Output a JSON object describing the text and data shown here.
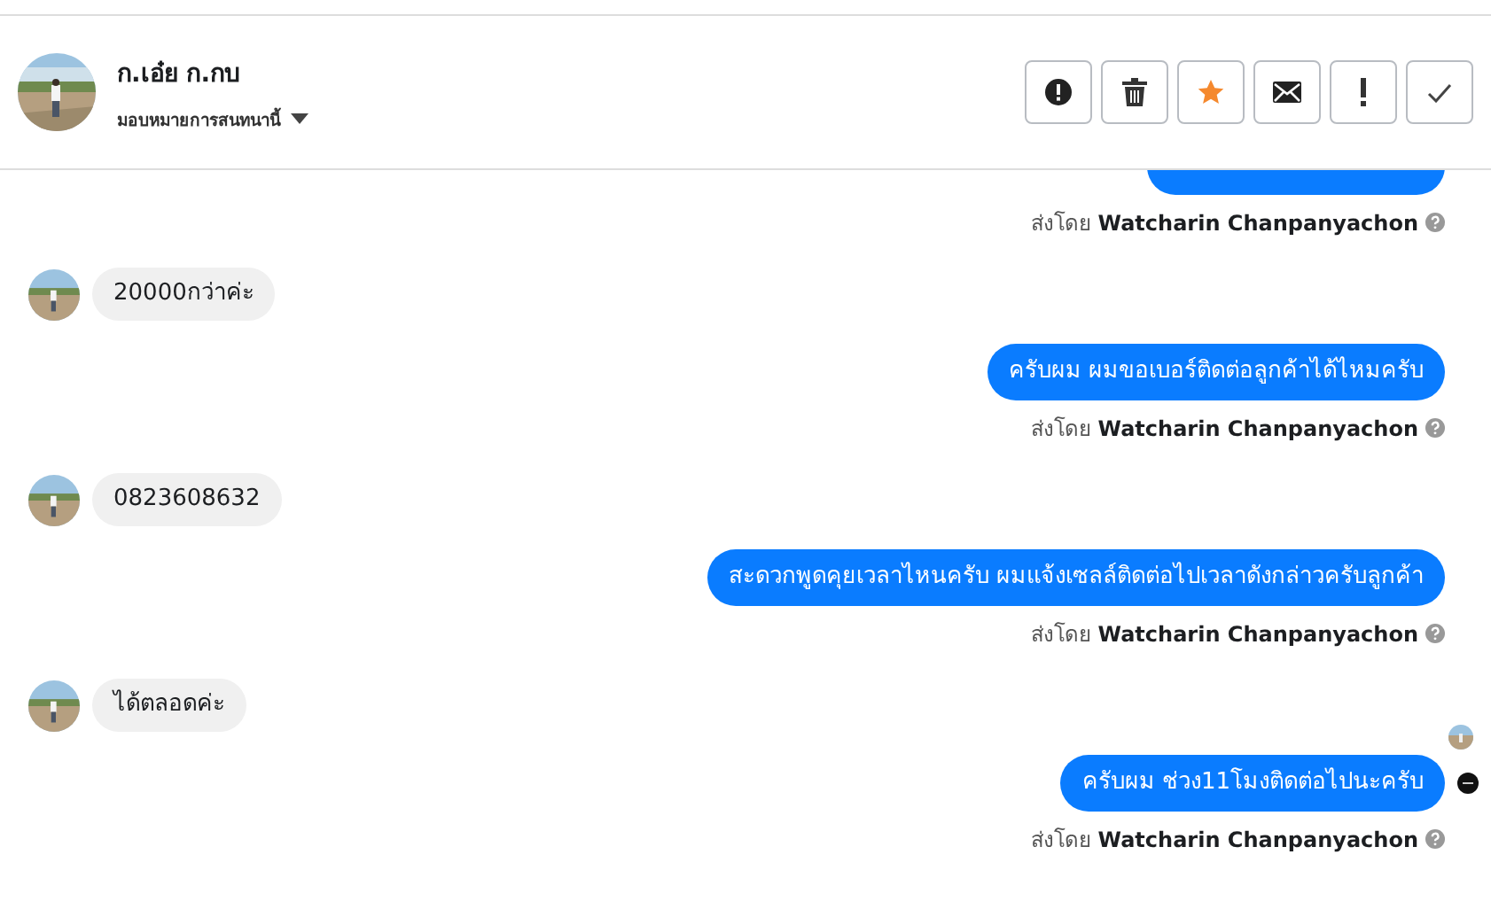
{
  "header": {
    "name": "ก.เอ๋ย ก.กบ",
    "assign_label": "มอบหมายการสนทนานี้",
    "actions": [
      {
        "kind": "alert"
      },
      {
        "kind": "trash"
      },
      {
        "kind": "star"
      },
      {
        "kind": "mail"
      },
      {
        "kind": "exclaim"
      },
      {
        "kind": "check"
      }
    ]
  },
  "messages": [
    {
      "kind": "outgoing_cut",
      "sender_prefix": "ส่งโดย",
      "sender": "Watcharin Chanpanyachon",
      "status_icon": false
    },
    {
      "kind": "incoming",
      "text": "20000กว่าค่ะ",
      "seen": false
    },
    {
      "kind": "outgoing",
      "text": "ครับผม ผมขอเบอร์ติดต่อลูกค้าได้ไหมครับ",
      "sender_prefix": "ส่งโดย",
      "sender": "Watcharin Chanpanyachon",
      "status_icon": false
    },
    {
      "kind": "incoming",
      "text": "0823608632",
      "seen": false
    },
    {
      "kind": "outgoing",
      "text": "สะดวกพูดคุยเวลาไหนครับ ผมแจ้งเซลล์ติดต่อไปเวลาดังกล่าวครับลูกค้า",
      "sender_prefix": "ส่งโดย",
      "sender": "Watcharin Chanpanyachon",
      "status_icon": false
    },
    {
      "kind": "incoming",
      "text": "ได้ตลอดค่ะ",
      "seen": true
    },
    {
      "kind": "outgoing",
      "text": "ครับผม ช่วง11โมงติดต่อไปนะครับ",
      "sender_prefix": "ส่งโดย",
      "sender": "Watcharin Chanpanyachon",
      "status_icon": true
    }
  ]
}
